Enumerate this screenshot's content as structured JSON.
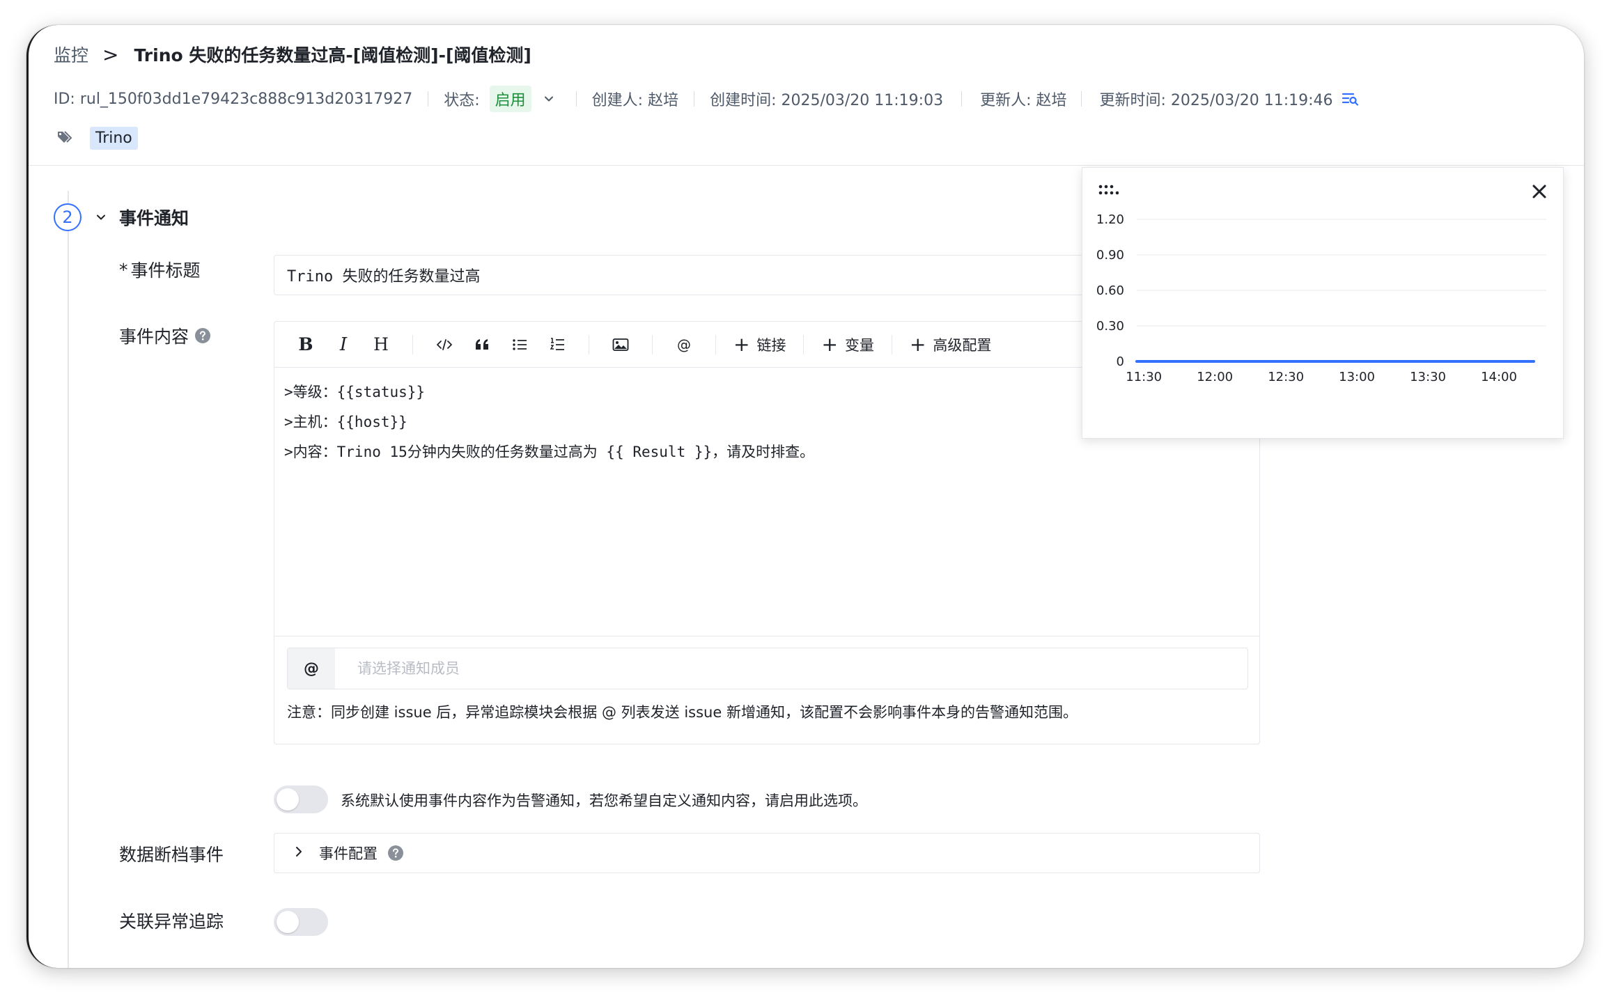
{
  "breadcrumb": {
    "root": "监控",
    "separator": ">",
    "title": "Trino 失败的任务数量过高-[阈值检测]-[阈值检测]"
  },
  "meta": {
    "id": "ID: rul_150f03dd1e79423c888c913d20317927",
    "status_label": "状态:",
    "status_value": "启用",
    "creator": "创建人: 赵培",
    "created_time": "创建时间: 2025/03/20 11:19:03",
    "updater": "更新人: 赵培",
    "updated_time": "更新时间: 2025/03/20 11:19:46"
  },
  "tags": [
    "Trino"
  ],
  "section": {
    "step": "2",
    "title": "事件通知"
  },
  "form": {
    "title_label": "事件标题",
    "required_mark": "*",
    "title_value": "Trino 失败的任务数量过高",
    "content_label": "事件内容",
    "toolbar": {
      "bold": "B",
      "italic": "I",
      "heading": "H",
      "link_label": "链接",
      "variable_label": "变量",
      "advanced_label": "高级配置",
      "plus": "+",
      "at": "@"
    },
    "content_lines": [
      ">等级：{{status}}",
      ">主机：{{host}}",
      ">内容：Trino 15分钟内失败的任务数量过高为 {{ Result }}，请及时排查。"
    ],
    "mention_at": "@",
    "mention_placeholder": "请选择通知成员",
    "note": "注意：同步创建 issue 后，异常追踪模块会根据 @ 列表发送 issue 新增通知，该配置不会影响事件本身的告警通知范围。",
    "custom_toggle_text": "系统默认使用事件内容作为告警通知，若您希望自定义通知内容，请启用此选项。",
    "custom_toggle_on": false,
    "data_gap_label": "数据断档事件",
    "event_config_label": "事件配置",
    "issue_tracking_label": "关联异常追踪",
    "issue_tracking_on": false
  },
  "colors": {
    "accent": "#3370ff",
    "status_green": "#1b8f3a",
    "tag_bg": "#d9e7fd",
    "line": "#3370ff"
  },
  "chart_data": {
    "type": "line",
    "x": [
      "11:30",
      "12:00",
      "12:30",
      "13:00",
      "13:30",
      "14:00"
    ],
    "x_start": "11:27",
    "x_end": "14:20",
    "series": [
      {
        "values": [
          0,
          0,
          0,
          0,
          0,
          0
        ]
      }
    ],
    "yticks": [
      "0",
      "0.30",
      "0.60",
      "0.90",
      "1.20"
    ],
    "ylim": [
      0,
      1.2
    ],
    "grid": true,
    "title": "",
    "xlabel": "",
    "ylabel": ""
  }
}
